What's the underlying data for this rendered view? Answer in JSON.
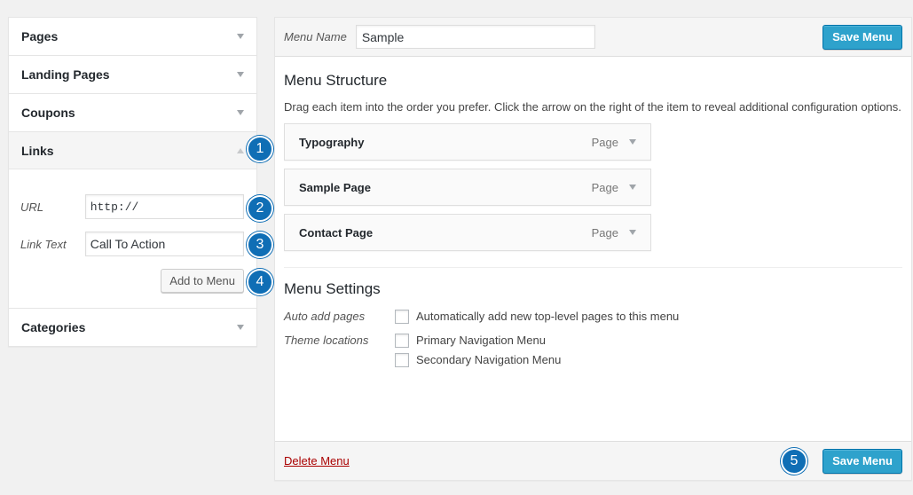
{
  "sidebar": {
    "sections": [
      {
        "label": "Pages"
      },
      {
        "label": "Landing Pages"
      },
      {
        "label": "Coupons"
      },
      {
        "label": "Links"
      },
      {
        "label": "Categories"
      }
    ],
    "links": {
      "url_label": "URL",
      "url_value": "http://",
      "link_text_label": "Link Text",
      "link_text_value": "Call To Action",
      "add_button": "Add to Menu"
    }
  },
  "menu": {
    "name_label": "Menu Name",
    "name_value": "Sample",
    "save_label": "Save Menu",
    "structure_title": "Menu Structure",
    "instructions": "Drag each item into the order you prefer. Click the arrow on the right of the item to reveal additional configuration options.",
    "items": [
      {
        "title": "Typography",
        "type": "Page"
      },
      {
        "title": "Sample Page",
        "type": "Page"
      },
      {
        "title": "Contact Page",
        "type": "Page"
      }
    ],
    "settings_title": "Menu Settings",
    "auto_add_label": "Auto add pages",
    "auto_add_option": "Automatically add new top-level pages to this menu",
    "theme_locations_label": "Theme locations",
    "locations": [
      "Primary Navigation Menu",
      "Secondary Navigation Menu"
    ],
    "delete_label": "Delete Menu"
  },
  "callouts": [
    "1",
    "2",
    "3",
    "4",
    "5"
  ],
  "colors": {
    "primary_button": "#2ea2cc",
    "badge": "#0f6eb5",
    "delete_link": "#aa0000"
  }
}
